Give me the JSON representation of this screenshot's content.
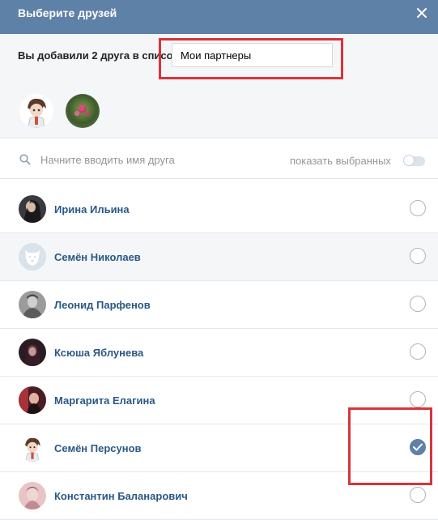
{
  "header": {
    "title": "Выберите друзей"
  },
  "list": {
    "label": "Вы добавили 2 друга в список",
    "name_value": "Мои партнеры"
  },
  "selected_friends": [
    {
      "avatar": "cartoon-boy-avatar"
    },
    {
      "avatar": "flower-photo-avatar"
    }
  ],
  "search": {
    "placeholder": "Начните вводить имя друга",
    "show_selected_label": "показать выбранных",
    "show_selected_on": false
  },
  "friends": [
    {
      "name": "Ирина Ильина",
      "checked": false,
      "avatar": "photo-dark-hair"
    },
    {
      "name": "Семён Николаев",
      "checked": false,
      "avatar": "default-dog-avatar"
    },
    {
      "name": "Леонид Парфенов",
      "checked": false,
      "avatar": "photo-grey"
    },
    {
      "name": "Ксюша Яблунева",
      "checked": false,
      "avatar": "photo-dark-red"
    },
    {
      "name": "Маргарита Елагина",
      "checked": false,
      "avatar": "photo-red-light"
    },
    {
      "name": "Семён Персунов",
      "checked": true,
      "avatar": "cartoon-boy-avatar"
    },
    {
      "name": "Константин Баланарович",
      "checked": false,
      "avatar": "photo-pink"
    }
  ],
  "colors": {
    "header": "#5e81a8",
    "link": "#2a5885",
    "highlight": "#d9343b"
  }
}
